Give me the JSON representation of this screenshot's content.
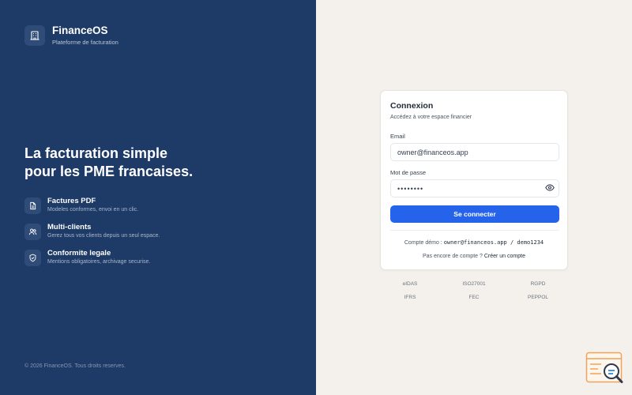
{
  "brand": {
    "name": "FinanceOS",
    "subtitle": "Plateforme de facturation",
    "icon": "building-icon"
  },
  "hero": {
    "headline_line1": "La facturation simple",
    "headline_line2": "pour les PME francaises."
  },
  "features": [
    {
      "icon": "document-icon",
      "title": "Factures PDF",
      "description": "Modeles conformes, envoi en un clic."
    },
    {
      "icon": "users-icon",
      "title": "Multi-clients",
      "description": "Gerez tous vos clients depuis un seul espace."
    },
    {
      "icon": "shield-check-icon",
      "title": "Conformite legale",
      "description": "Mentions obligatoires, archivage securise."
    }
  ],
  "copyright": "© 2026 FinanceOS. Tous droits reserves.",
  "login": {
    "title": "Connexion",
    "subtitle": "Accédez à votre espace financier",
    "email_label": "Email",
    "email_value": "owner@financeos.app",
    "password_label": "Mot de passe",
    "password_value": "demo1234",
    "submit_label": "Se connecter",
    "demo_prefix": "Compte démo :",
    "demo_credentials": "owner@financeos.app / demo1234",
    "signup_prefix": "Pas encore de compte ?",
    "signup_link": "Créer un compte"
  },
  "badges": [
    "eIDAS",
    "ISO27001",
    "RGPD",
    "IFRS",
    "FEC",
    "PEPPOL"
  ],
  "colors": {
    "panel": "#1e3a66",
    "accent": "#2563eb",
    "background": "#f4f1ec"
  }
}
